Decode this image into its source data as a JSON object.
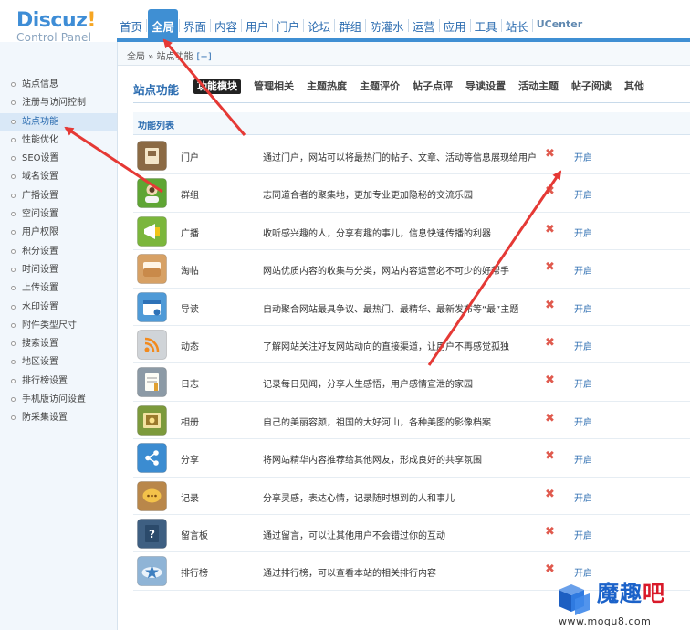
{
  "logo": {
    "brand_part1": "Discuz",
    "brand_part2": "!",
    "subtitle": "Control Panel"
  },
  "topnav": {
    "items": [
      {
        "label": "首页",
        "active": false
      },
      {
        "label": "全局",
        "active": true
      },
      {
        "label": "界面",
        "active": false
      },
      {
        "label": "内容",
        "active": false
      },
      {
        "label": "用户",
        "active": false
      },
      {
        "label": "门户",
        "active": false
      },
      {
        "label": "论坛",
        "active": false
      },
      {
        "label": "群组",
        "active": false
      },
      {
        "label": "防灌水",
        "active": false
      },
      {
        "label": "运营",
        "active": false
      },
      {
        "label": "应用",
        "active": false
      },
      {
        "label": "工具",
        "active": false
      },
      {
        "label": "站长",
        "active": false
      },
      {
        "label": "UCenter",
        "active": false
      }
    ]
  },
  "sidebar": {
    "items": [
      {
        "label": "站点信息"
      },
      {
        "label": "注册与访问控制"
      },
      {
        "label": "站点功能",
        "active": true
      },
      {
        "label": "性能优化"
      },
      {
        "label": "SEO设置"
      },
      {
        "label": "域名设置"
      },
      {
        "label": "广播设置"
      },
      {
        "label": "空间设置"
      },
      {
        "label": "用户权限"
      },
      {
        "label": "积分设置"
      },
      {
        "label": "时间设置"
      },
      {
        "label": "上传设置"
      },
      {
        "label": "水印设置"
      },
      {
        "label": "附件类型尺寸"
      },
      {
        "label": "搜索设置"
      },
      {
        "label": "地区设置"
      },
      {
        "label": "排行榜设置"
      },
      {
        "label": "手机版访问设置"
      },
      {
        "label": "防采集设置"
      }
    ]
  },
  "breadcrumb": {
    "text": "全局 » 站点功能",
    "plus": "[+]"
  },
  "section": {
    "title": "站点功能",
    "tabs": [
      {
        "label": "功能模块",
        "active": true
      },
      {
        "label": "管理相关"
      },
      {
        "label": "主题热度"
      },
      {
        "label": "主题评价"
      },
      {
        "label": "帖子点评"
      },
      {
        "label": "导读设置"
      },
      {
        "label": "活动主题"
      },
      {
        "label": "帖子阅读"
      },
      {
        "label": "其他"
      }
    ]
  },
  "list": {
    "header": "功能列表",
    "close_glyph": "✖",
    "rows": [
      {
        "icon": "portal-icon",
        "name": "门户",
        "desc": "通过门户，网站可以将最热门的帖子、文章、活动等信息展现给用户",
        "action": "开启",
        "color": "#8b6a44"
      },
      {
        "icon": "group-icon",
        "name": "群组",
        "desc": "志同道合者的聚集地，更加专业更加隐秘的交流乐园",
        "action": "开启",
        "color": "#5fa534"
      },
      {
        "icon": "broadcast-icon",
        "name": "广播",
        "desc": "收听感兴趣的人，分享有趣的事儿，信息快速传播的利器",
        "action": "开启",
        "color": "#7bb63c"
      },
      {
        "icon": "collection-icon",
        "name": "淘帖",
        "desc": "网站优质内容的收集与分类，网站内容运营必不可少的好帮手",
        "action": "开启",
        "color": "#d7a165"
      },
      {
        "icon": "guide-icon",
        "name": "导读",
        "desc": "自动聚合网站最具争议、最热门、最精华、最新发布等“最”主题",
        "action": "开启",
        "color": "#4f9ad7"
      },
      {
        "icon": "feed-icon",
        "name": "动态",
        "desc": "了解网站关注好友网站动向的直接渠道，让用户不再感觉孤独",
        "action": "开启",
        "color": "#d0d4d8"
      },
      {
        "icon": "blog-icon",
        "name": "日志",
        "desc": "记录每日见闻，分享人生感悟，用户感情宣泄的家园",
        "action": "开启",
        "color": "#8c9aa6"
      },
      {
        "icon": "album-icon",
        "name": "相册",
        "desc": "自己的美丽容颜，祖国的大好河山，各种美图的影像档案",
        "action": "开启",
        "color": "#7c9a3c"
      },
      {
        "icon": "share-icon",
        "name": "分享",
        "desc": "将网站精华内容推荐给其他网友，形成良好的共享氛围",
        "action": "开启",
        "color": "#3b8cd1"
      },
      {
        "icon": "doing-icon",
        "name": "记录",
        "desc": "分享灵感，表达心情，记录随时想到的人和事儿",
        "action": "开启",
        "color": "#b9874a"
      },
      {
        "icon": "guestbook-icon",
        "name": "留言板",
        "desc": "通过留言，可以让其他用户不会错过你的互动",
        "action": "开启",
        "color": "#3e5f82"
      },
      {
        "icon": "ranklist-icon",
        "name": "排行榜",
        "desc": "通过排行榜，可以查看本站的相关排行内容",
        "action": "开启",
        "color": "#8fb4d6"
      }
    ]
  },
  "watermark": {
    "text_part1": "魔趣",
    "text_part2": "吧",
    "url": "www.moqu8.com"
  },
  "annotation_color": "#e53935"
}
